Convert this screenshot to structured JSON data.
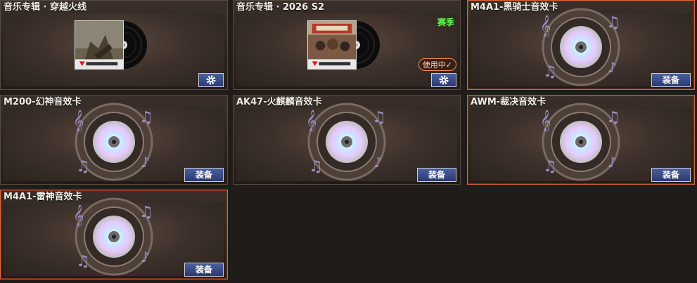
{
  "cards": [
    {
      "title": "音乐专辑 · 穿越火线",
      "type": "album",
      "highlight": false
    },
    {
      "title": "音乐专辑 · 2026 S2",
      "type": "album",
      "highlight": false,
      "tag": "赛季",
      "status": "使用中✓"
    },
    {
      "title": "M4A1-黑骑士音效卡",
      "type": "sound",
      "highlight": true,
      "button": "装备"
    },
    {
      "title": "M200-幻神音效卡",
      "type": "sound",
      "highlight": false,
      "button": "装备"
    },
    {
      "title": "AK47-火麒麟音效卡",
      "type": "sound",
      "highlight": false,
      "button": "装备"
    },
    {
      "title": "AWM-裁决音效卡",
      "type": "sound",
      "highlight": true,
      "button": "装备"
    },
    {
      "title": "M4A1-雷神音效卡",
      "type": "sound",
      "highlight": true,
      "button": "装备"
    }
  ],
  "icons": {
    "settings": "gear-icon",
    "sound": "speaker-disc-icon",
    "album": "vinyl-record-icon"
  },
  "colors": {
    "highlight_border": "#d8653b",
    "season_tag": "#5dff4b",
    "button_bg": "#2a3a72"
  }
}
